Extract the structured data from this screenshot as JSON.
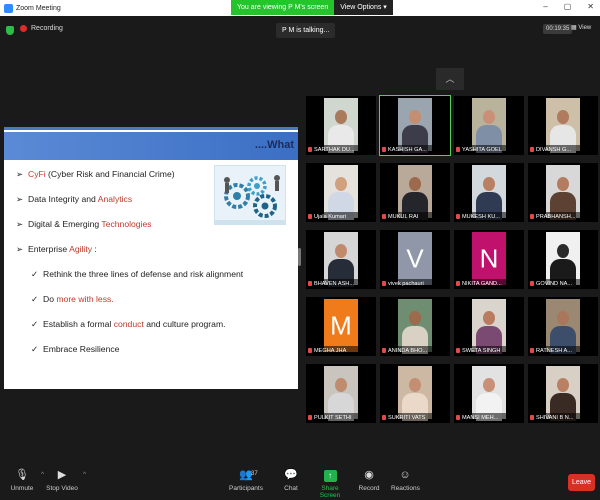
{
  "window": {
    "title": "Zoom Meeting",
    "viewing_banner": "You are viewing P M's screen",
    "view_options": "View Options",
    "view_options_caret": "▾",
    "controls": {
      "minimize": "–",
      "maximize": "▢",
      "close": "✕"
    }
  },
  "meeting": {
    "recording_label": "Recording",
    "talking": "P M is talking...",
    "timer": "00:19:35",
    "view_label": "View",
    "collapse_glyph": "︿"
  },
  "slide": {
    "title": "....What",
    "bullets": [
      {
        "marker": "➢",
        "parts": [
          {
            "t": "CyFi",
            "hl": true
          },
          {
            "t": " (Cyber Risk and Financial Crime)",
            "hl": false
          }
        ]
      },
      {
        "marker": "➢",
        "parts": [
          {
            "t": "Data Integrity and ",
            "hl": false
          },
          {
            "t": "Analytics",
            "hl": true
          }
        ]
      },
      {
        "marker": "➢",
        "parts": [
          {
            "t": "Digital & Emerging ",
            "hl": false
          },
          {
            "t": "Technologies",
            "hl": true
          }
        ]
      },
      {
        "marker": "➢",
        "parts": [
          {
            "t": "Enterprise ",
            "hl": false
          },
          {
            "t": "Agility",
            "hl": true
          },
          {
            "t": " :",
            "hl": false
          }
        ]
      },
      {
        "marker": "✓",
        "sub": true,
        "parts": [
          {
            "t": "Rethink the three lines of defense  and risk alignment",
            "hl": false
          }
        ]
      },
      {
        "marker": "✓",
        "sub": true,
        "parts": [
          {
            "t": "Do ",
            "hl": false
          },
          {
            "t": "more with less.",
            "hl": true
          }
        ]
      },
      {
        "marker": "✓",
        "sub": true,
        "parts": [
          {
            "t": "Establish a formal ",
            "hl": false
          },
          {
            "t": "conduct",
            "hl": true
          },
          {
            "t": " and culture program.",
            "hl": false
          }
        ]
      },
      {
        "marker": "✓",
        "sub": true,
        "parts": [
          {
            "t": "Embrace Resilience",
            "hl": false
          }
        ]
      }
    ]
  },
  "participants_grid": [
    {
      "name": "SARTHAK DU...",
      "kind": "video",
      "bg": "#cfd7cf",
      "skin": "#a97a5c",
      "shirt": "#e9e9e9"
    },
    {
      "name": "KASHISH GA...",
      "kind": "video",
      "bg": "#9aa5b0",
      "skin": "#c48e72",
      "shirt": "#3c3c4a",
      "active": true
    },
    {
      "name": "YASHITA GOEL",
      "kind": "video",
      "bg": "#b9b39c",
      "skin": "#c99077",
      "shirt": "#7e8fa6"
    },
    {
      "name": "DIVANSH G...",
      "kind": "video",
      "bg": "#cdbfa8",
      "skin": "#b07b5e",
      "shirt": "#e6e6e6"
    },
    {
      "name": "Ujala Kumari",
      "kind": "video",
      "bg": "#e5e1dc",
      "skin": "#d1a07f",
      "shirt": "#cfd8e4"
    },
    {
      "name": "MUKUL RAI",
      "kind": "video",
      "bg": "#b8a999",
      "skin": "#9c6a4c",
      "shirt": "#25252c"
    },
    {
      "name": "MUKESH KU...",
      "kind": "video",
      "bg": "#d3d8dd",
      "skin": "#b98063",
      "shirt": "#2f3b52"
    },
    {
      "name": "PRABHANSH...",
      "kind": "video",
      "bg": "#d8d8d8",
      "skin": "#b47d5f",
      "shirt": "#5d4132"
    },
    {
      "name": "BHAVEN ASH...",
      "kind": "video",
      "bg": "#d6d6d6",
      "skin": "#c08b6d",
      "shirt": "#262c38"
    },
    {
      "name": "vivek pachauri",
      "kind": "letter",
      "letter": "V",
      "bg": "#8f97a8"
    },
    {
      "name": "NIKITA GAND...",
      "kind": "letter",
      "letter": "N",
      "bg": "#c0116d"
    },
    {
      "name": "GOVIND NA...",
      "kind": "video",
      "bg": "#f0f0f0",
      "skin": "#2a2a2a",
      "shirt": "#1a1a1a"
    },
    {
      "name": "MEGHA JHA",
      "kind": "letter",
      "letter": "M",
      "bg": "#f07b1a"
    },
    {
      "name": "ANINDA BHO...",
      "kind": "video",
      "bg": "#6f8d71",
      "skin": "#9c6a4c",
      "shirt": "#d9d1c4"
    },
    {
      "name": "SWETA SINGH",
      "kind": "video",
      "bg": "#d9d4cc",
      "skin": "#b97c60",
      "shirt": "#7a4a72"
    },
    {
      "name": "RATNESH A...",
      "kind": "video",
      "bg": "#9a8872",
      "skin": "#a9775b",
      "shirt": "#3d4e6a"
    },
    {
      "name": "PULKIT SETHI",
      "kind": "video",
      "bg": "#c9c4bd",
      "skin": "#c08c6f",
      "shirt": "#d7d7d7"
    },
    {
      "name": "SUKRITI VATS",
      "kind": "video",
      "bg": "#cdb9a3",
      "skin": "#c48e72",
      "shirt": "#ead9c9"
    },
    {
      "name": "MANSI MEH...",
      "kind": "video",
      "bg": "#e2e2e2",
      "skin": "#c99077",
      "shirt": "#f2f2f2"
    },
    {
      "name": "SHIVANI B N...",
      "kind": "video",
      "bg": "#d8d0c4",
      "skin": "#b98063",
      "shirt": "#3a2a24"
    }
  ],
  "toolbar": {
    "unmute": "Unmute",
    "stop_video": "Stop Video",
    "participants": "Participants",
    "participants_count": "37",
    "chat": "Chat",
    "share_screen": "Share Screen",
    "record": "Record",
    "reactions": "Reactions",
    "leave": "Leave",
    "caret": "^"
  }
}
